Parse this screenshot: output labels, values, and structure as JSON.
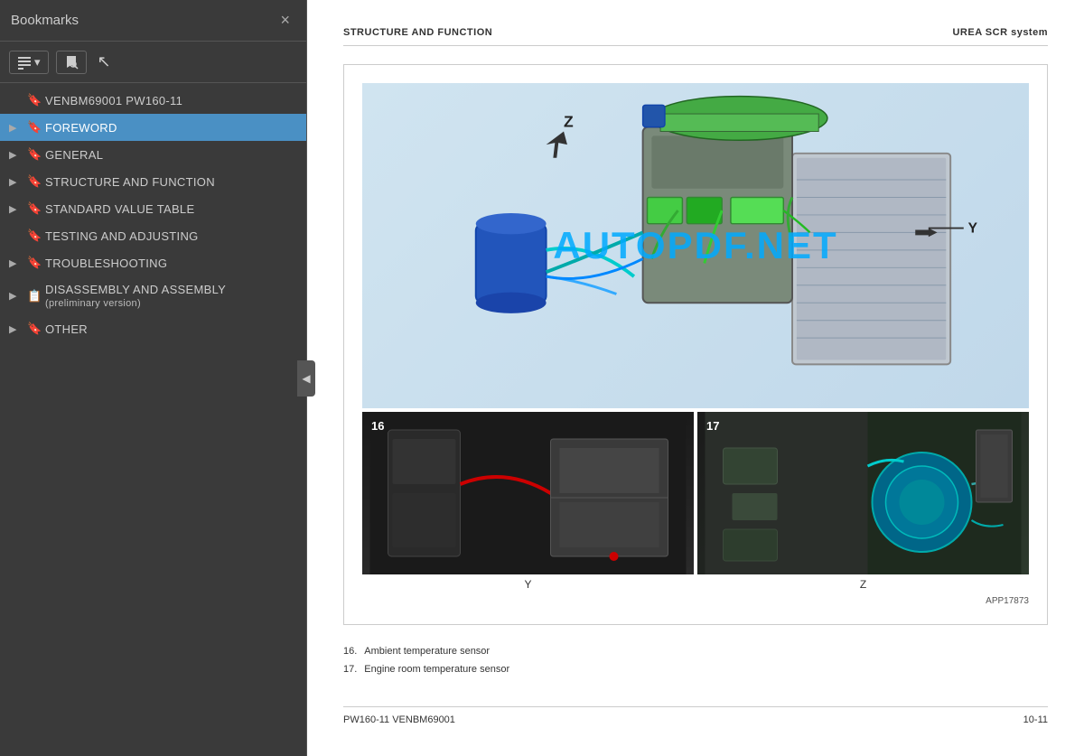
{
  "sidebar": {
    "title": "Bookmarks",
    "close_label": "×",
    "toolbar": {
      "list_icon": "list-icon",
      "bookmark_icon": "bookmark-search-icon",
      "dropdown_arrow": "▾"
    },
    "items": [
      {
        "id": "root",
        "label": "VENBM69001 PW160-11",
        "has_arrow": false,
        "has_bookmark": true,
        "active": false,
        "indent": 0
      },
      {
        "id": "foreword",
        "label": "FOREWORD",
        "has_arrow": true,
        "has_bookmark": true,
        "active": true,
        "indent": 0
      },
      {
        "id": "general",
        "label": "GENERAL",
        "has_arrow": true,
        "has_bookmark": true,
        "active": false,
        "indent": 0
      },
      {
        "id": "structure",
        "label": "STRUCTURE AND FUNCTION",
        "has_arrow": true,
        "has_bookmark": true,
        "active": false,
        "indent": 0
      },
      {
        "id": "standard",
        "label": "STANDARD VALUE TABLE",
        "has_arrow": true,
        "has_bookmark": true,
        "active": false,
        "indent": 0
      },
      {
        "id": "testing",
        "label": "TESTING AND ADJUSTING",
        "has_arrow": false,
        "has_bookmark": true,
        "active": false,
        "indent": 0
      },
      {
        "id": "troubleshooting",
        "label": "TROUBLESHOOTING",
        "has_arrow": true,
        "has_bookmark": true,
        "active": false,
        "indent": 0
      },
      {
        "id": "disassembly",
        "label": "DISASSEMBLY AND ASSEMBLY",
        "sublabel": "(preliminary version)",
        "has_arrow": true,
        "has_bookmark": true,
        "active": false,
        "indent": 0
      },
      {
        "id": "other",
        "label": "OTHER",
        "has_arrow": true,
        "has_bookmark": true,
        "active": false,
        "indent": 0
      }
    ]
  },
  "page": {
    "header_left": "STRUCTURE AND FUNCTION",
    "header_right": "UREA SCR system",
    "watermark": "AUTOPDF.NET",
    "diagram_ref": "APP17873",
    "sub_image_left_num": "16",
    "sub_image_right_num": "17",
    "sub_label_y": "Y",
    "sub_label_z": "Z",
    "arrow_z": "Z",
    "arrow_y": "Y",
    "parts": [
      {
        "num": "16.",
        "desc": "Ambient temperature sensor"
      },
      {
        "num": "17.",
        "desc": "Engine room temperature sensor"
      }
    ],
    "footer_left": "PW160-11  VENBM69001",
    "footer_right": "10-11"
  }
}
